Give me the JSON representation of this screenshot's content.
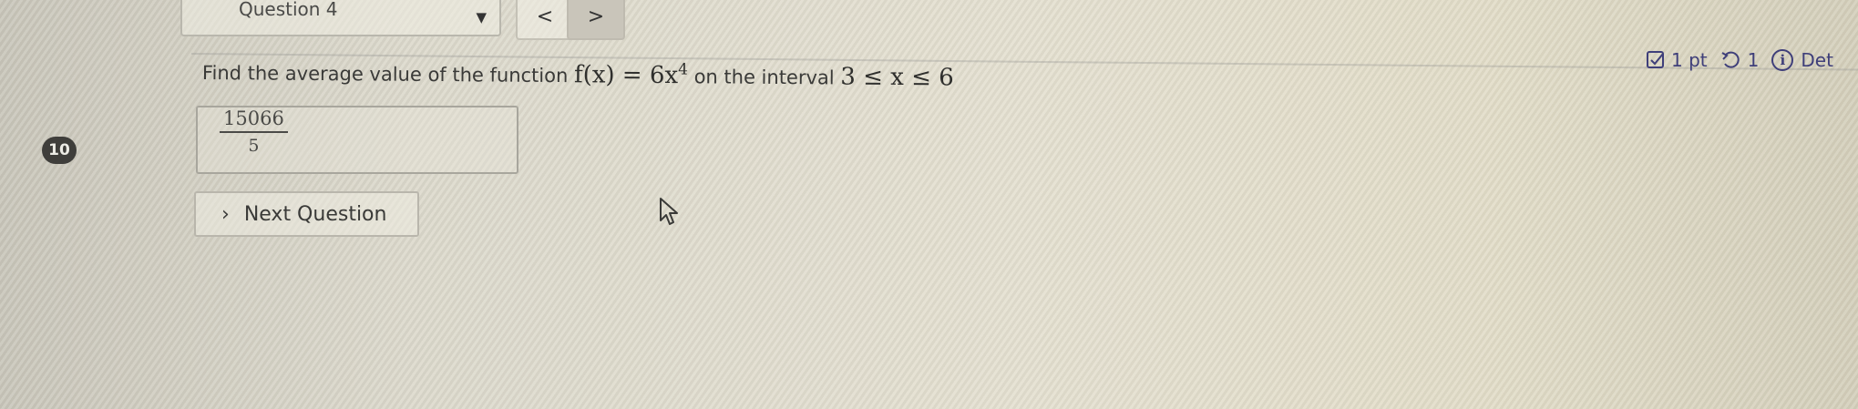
{
  "header": {
    "question_select_label": "Question 4",
    "prev_label": "<",
    "next_label": ">"
  },
  "question": {
    "number": "10",
    "prompt_text": "Find the average value of the function",
    "function_lhs": "f(x) = 6x",
    "function_exponent": "4",
    "interval_text": "on the interval",
    "interval_math": "3 ≤ x ≤ 6"
  },
  "answer": {
    "numerator": "15066",
    "denominator": "5"
  },
  "next_question_label": "Next Question",
  "meta": {
    "points": "1 pt",
    "attempts": "1",
    "details": "Det"
  },
  "colors": {
    "meta_accent": "#3f3f7a",
    "badge_bg": "#3f3e3b"
  }
}
